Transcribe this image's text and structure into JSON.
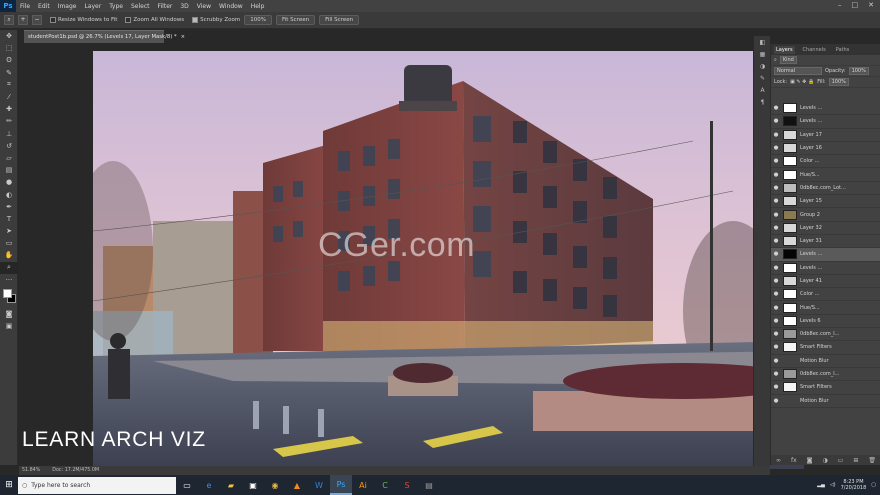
{
  "app": {
    "logo": "Ps",
    "window_buttons": [
      "–",
      "□",
      "✕"
    ]
  },
  "menu": [
    "File",
    "Edit",
    "Image",
    "Layer",
    "Type",
    "Select",
    "Filter",
    "3D",
    "View",
    "Window",
    "Help"
  ],
  "options_bar": {
    "tool_icons": [
      "zoom-tool-icon",
      "zoom-in-icon",
      "zoom-out-icon"
    ],
    "resize_windows": "Resize Windows to Fit",
    "zoom_all": "Zoom All Windows",
    "scrubby_zoom": "Scrubby Zoom",
    "zoom_100": "100%",
    "fit_screen": "Fit Screen",
    "fill_screen": "Fill Screen",
    "checks": {
      "resize_windows": false,
      "zoom_all": false,
      "scrubby_zoom": true
    }
  },
  "document": {
    "tab_title": "studentPost1b.psd @ 26.7% (Levels 17, Layer Mask/8) *",
    "tab_close": "×",
    "overlay_title": "LEARN ARCH VIZ",
    "watermark": "CGer.com"
  },
  "status": {
    "zoom": "51.84%",
    "doc_size": "Doc: 17.2M/475.0M"
  },
  "layers_panel": {
    "tabs": [
      "Layers",
      "Channels",
      "Paths"
    ],
    "kind_label": "Kind",
    "blend_mode": "Normal",
    "opacity_label": "Opacity:",
    "opacity_value": "100%",
    "lock_label": "Lock:",
    "fill_label": "Fill:",
    "fill_value": "100%",
    "layers": [
      {
        "name": "Levels ...",
        "thumb": "#ffffff",
        "visible": true,
        "selected": false
      },
      {
        "name": "Levels ...",
        "thumb": "#111111",
        "visible": true,
        "selected": false
      },
      {
        "name": "Layer 17",
        "thumb": "#d8d8d8",
        "visible": true,
        "selected": false
      },
      {
        "name": "Layer 16",
        "thumb": "#d8d8d8",
        "visible": true,
        "selected": false
      },
      {
        "name": "Color ...",
        "thumb": "#ffffff",
        "visible": true,
        "selected": false
      },
      {
        "name": "Hue/S...",
        "thumb": "#ffffff",
        "visible": true,
        "selected": false
      },
      {
        "name": "0db8ec.com_Lot...",
        "thumb": "#bdbdbd",
        "visible": true,
        "selected": false
      },
      {
        "name": "Layer 15",
        "thumb": "#d8d8d8",
        "visible": true,
        "selected": false
      },
      {
        "name": "Group 2",
        "thumb": "#8a7a52",
        "visible": true,
        "selected": false
      },
      {
        "name": "Layer 32",
        "thumb": "#d8d8d8",
        "visible": true,
        "selected": false
      },
      {
        "name": "Layer 31",
        "thumb": "#d8d8d8",
        "visible": true,
        "selected": false
      },
      {
        "name": "Levels ...",
        "thumb": "#050505",
        "visible": true,
        "selected": true
      },
      {
        "name": "Levels ...",
        "thumb": "#ffffff",
        "visible": true,
        "selected": false
      },
      {
        "name": "Layer 41",
        "thumb": "#d8d8d8",
        "visible": true,
        "selected": false
      },
      {
        "name": "Color ...",
        "thumb": "#ffffff",
        "visible": true,
        "selected": false
      },
      {
        "name": "Hue/S...",
        "thumb": "#ffffff",
        "visible": true,
        "selected": false
      },
      {
        "name": "Levels 6",
        "thumb": "#ffffff",
        "visible": true,
        "selected": false
      },
      {
        "name": "0db8ec.com_l...",
        "thumb": "#9a9a9a",
        "visible": true,
        "selected": false
      },
      {
        "name": "Smart Filters",
        "thumb": "#f4f4f4",
        "visible": true,
        "selected": false
      },
      {
        "name": "Motion Blur",
        "thumb": "",
        "visible": true,
        "selected": false
      },
      {
        "name": "0db8ec.com_l...",
        "thumb": "#9a9a9a",
        "visible": true,
        "selected": false
      },
      {
        "name": "Smart Filters",
        "thumb": "#f4f4f4",
        "visible": true,
        "selected": false
      },
      {
        "name": "Motion Blur",
        "thumb": "",
        "visible": true,
        "selected": false
      }
    ],
    "footer_icons": [
      "link-icon",
      "fx-icon",
      "mask-icon",
      "adjustment-icon",
      "folder-icon",
      "new-layer-icon",
      "trash-icon"
    ]
  },
  "taskbar": {
    "search_placeholder": "Type here to search",
    "apps": [
      "task-view-icon",
      "edge-icon",
      "file-explorer-icon",
      "store-icon",
      "chrome-icon",
      "vlc-icon",
      "word-icon",
      "photoshop-icon",
      "illustrator-icon",
      "camtasia-icon",
      "sketchup-icon",
      "media-icon"
    ],
    "active_app": "photoshop-icon",
    "time": "8:23 PM",
    "date": "7/20/2018"
  }
}
